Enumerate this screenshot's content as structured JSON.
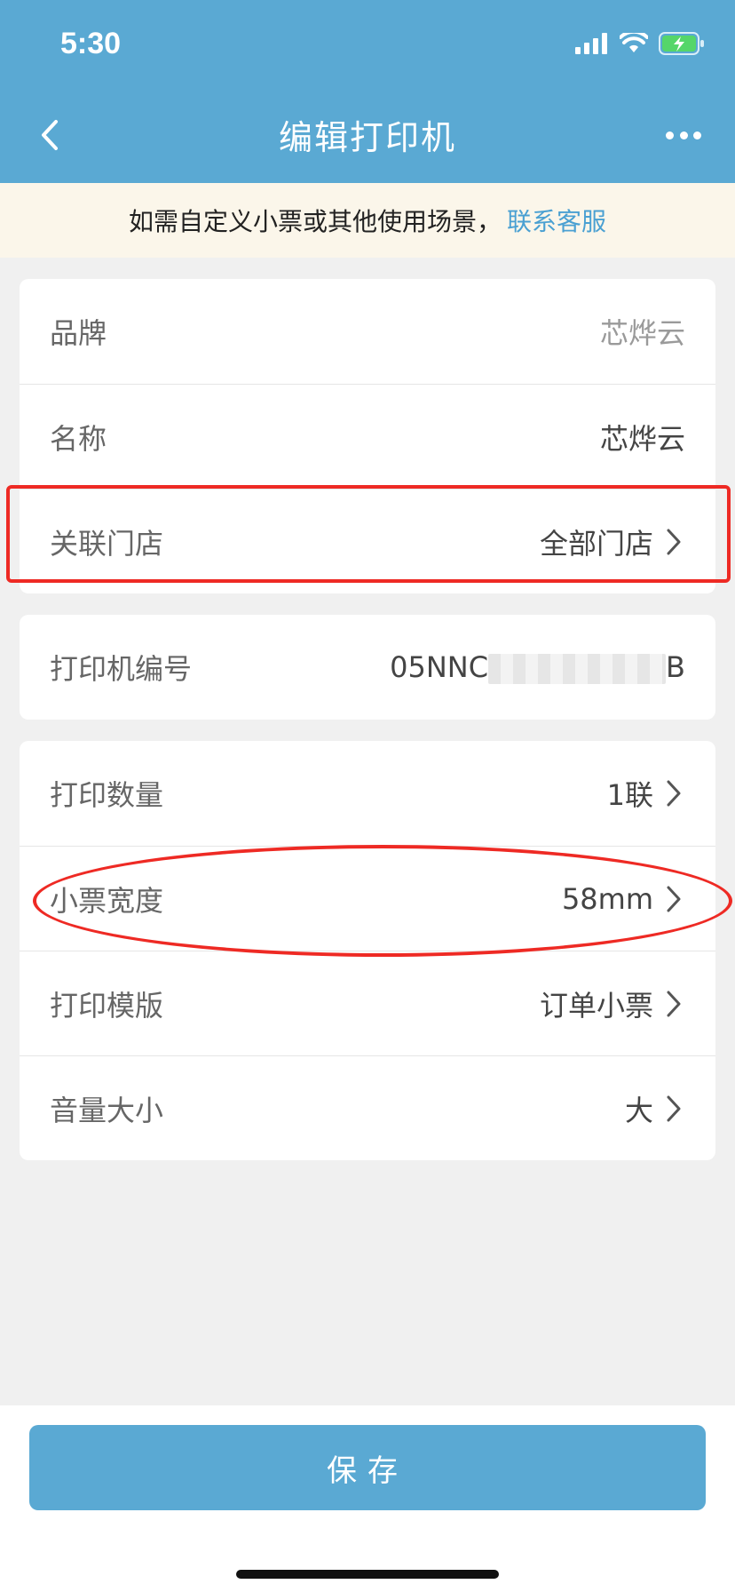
{
  "status_bar": {
    "time": "5:30"
  },
  "nav": {
    "title": "编辑打印机"
  },
  "notice": {
    "text": "如需自定义小票或其他使用场景，",
    "link": "联系客服"
  },
  "section1": {
    "brand": {
      "label": "品牌",
      "value": "芯烨云"
    },
    "name": {
      "label": "名称",
      "value": "芯烨云"
    },
    "store": {
      "label": "关联门店",
      "value": "全部门店"
    }
  },
  "section2": {
    "printer_no": {
      "label": "打印机编号",
      "value_prefix": "05NNC",
      "value_suffix": "B"
    }
  },
  "section3": {
    "count": {
      "label": "打印数量",
      "value": "1联"
    },
    "width": {
      "label": "小票宽度",
      "value": "58mm"
    },
    "template": {
      "label": "打印模版",
      "value": "订单小票"
    },
    "volume": {
      "label": "音量大小",
      "value": "大"
    }
  },
  "footer": {
    "save_label": "保存"
  },
  "colors": {
    "primary": "#5aa9d3",
    "link": "#4aa0d2",
    "notice_bg": "#fbf6ea",
    "annotation_red": "#ee2a24"
  },
  "icons": [
    "back-icon",
    "more-icon",
    "signal-icon",
    "wifi-icon",
    "battery-charging-icon",
    "chevron-right-icon"
  ]
}
